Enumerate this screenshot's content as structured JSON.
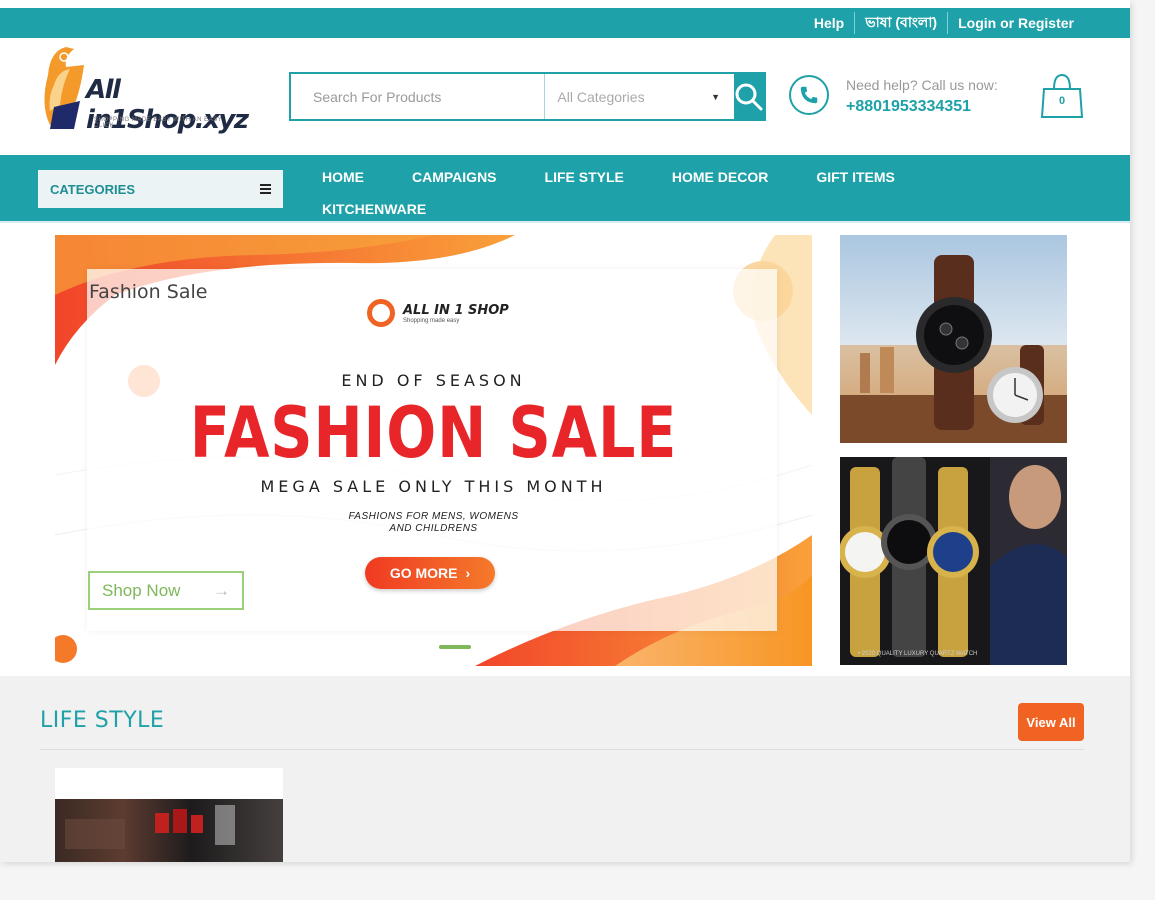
{
  "topbar": {
    "help": "Help",
    "language": "ভাষা (বাংলা)",
    "login": "Login or Register"
  },
  "logo": {
    "name": "All in1Shop.xyz",
    "tagline": "SHOPPING MADE EASY WITH AN EASY CLICK"
  },
  "search": {
    "placeholder": "Search For Products",
    "category": "All Categories"
  },
  "help": {
    "line1": "Need help? Call us now:",
    "phone": "+8801953334351"
  },
  "cart": {
    "count": "0"
  },
  "nav": {
    "categories_label": "CATEGORIES",
    "links": [
      "HOME",
      "CAMPAIGNS",
      "LIFE STYLE",
      "HOME DECOR",
      "GIFT ITEMS",
      "KITCHENWARE"
    ]
  },
  "banner": {
    "label": "Fashion Sale",
    "brand": "ALL IN 1 SHOP",
    "brand_sub": "Shopping made easy",
    "eyebrow": "END OF SEASON",
    "headline": "FASHION SALE",
    "subhead": "MEGA SALE ONLY THIS MONTH",
    "line1": "FASHIONS FOR MENS, WOMENS",
    "line2": "AND CHILDRENS",
    "cta": "GO MORE",
    "shop_now": "Shop Now",
    "active_slide": 2,
    "slide_count": 2
  },
  "side_banner2": {
    "caption": "• 2020 QUALITY LUXURY QUARTZ WATCH"
  },
  "section": {
    "title": "LIFE STYLE",
    "view_all": "View All"
  },
  "colors": {
    "teal": "#1ea1a8",
    "orange": "#f06322",
    "sale_red": "#e8262a"
  }
}
